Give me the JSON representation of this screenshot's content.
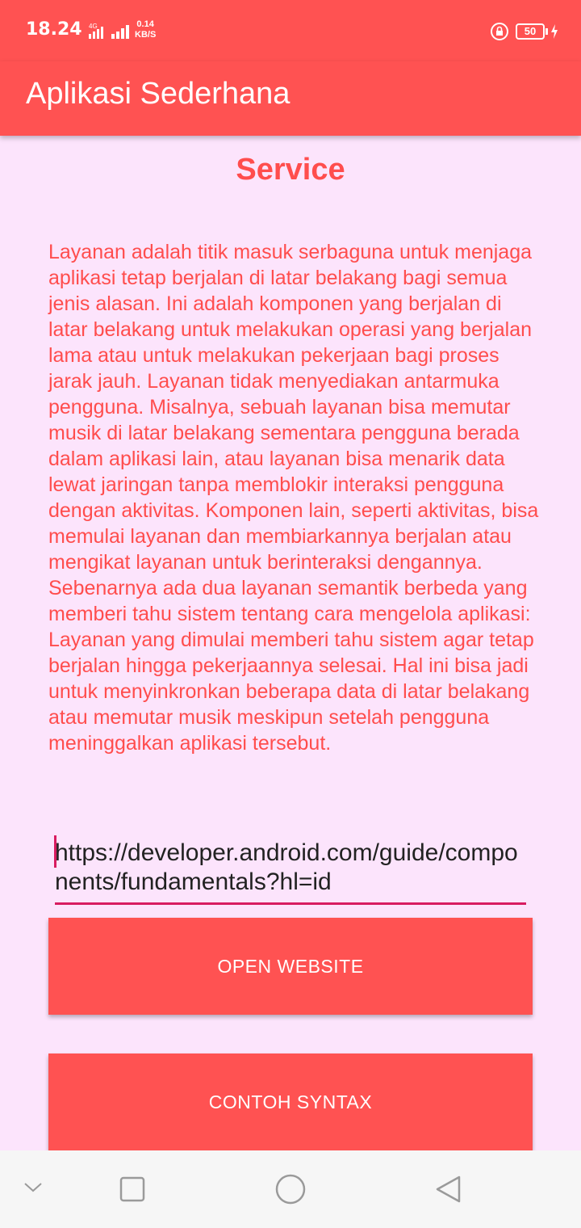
{
  "status_bar": {
    "time": "18.24",
    "network_label": "4G",
    "speed_value": "0.14",
    "speed_unit": "KB/S",
    "battery_level": "50"
  },
  "app_bar": {
    "title": "Aplikasi Sederhana"
  },
  "main": {
    "heading": "Service",
    "description": "Layanan adalah titik masuk serbaguna untuk menjaga aplikasi tetap berjalan di latar belakang bagi semua jenis alasan. Ini adalah komponen yang berjalan di latar belakang untuk melakukan operasi yang berjalan lama atau untuk melakukan pekerjaan bagi proses jarak jauh. Layanan tidak menyediakan antarmuka pengguna. Misalnya, sebuah layanan bisa memutar musik di latar belakang sementara pengguna berada dalam aplikasi lain, atau layanan bisa menarik data lewat jaringan tanpa memblokir interaksi pengguna dengan aktivitas. Komponen lain, seperti aktivitas, bisa memulai layanan dan membiarkannya berjalan atau mengikat layanan untuk berinteraksi dengannya. Sebenarnya ada dua layanan semantik berbeda yang memberi tahu sistem tentang cara mengelola aplikasi: Layanan yang dimulai memberi tahu sistem agar tetap berjalan hingga pekerjaannya selesai. Hal ini bisa jadi untuk menyinkronkan beberapa data di latar belakang atau memutar musik meskipun setelah pengguna meninggalkan aplikasi tersebut.",
    "url_input_value": "https://developer.android.com/guide/components/fundamentals?hl=id",
    "open_website_label": "OPEN WEBSITE",
    "contoh_syntax_label": "CONTOH SYNTAX"
  },
  "nav_bar": {
    "icons": [
      "chevron-down-icon",
      "recents-square-icon",
      "home-circle-icon",
      "back-triangle-icon"
    ]
  },
  "colors": {
    "accent": "#ff5252",
    "text_accent": "#ff4d4d",
    "background": "#fce4fc",
    "input_underline": "#d81b60"
  }
}
